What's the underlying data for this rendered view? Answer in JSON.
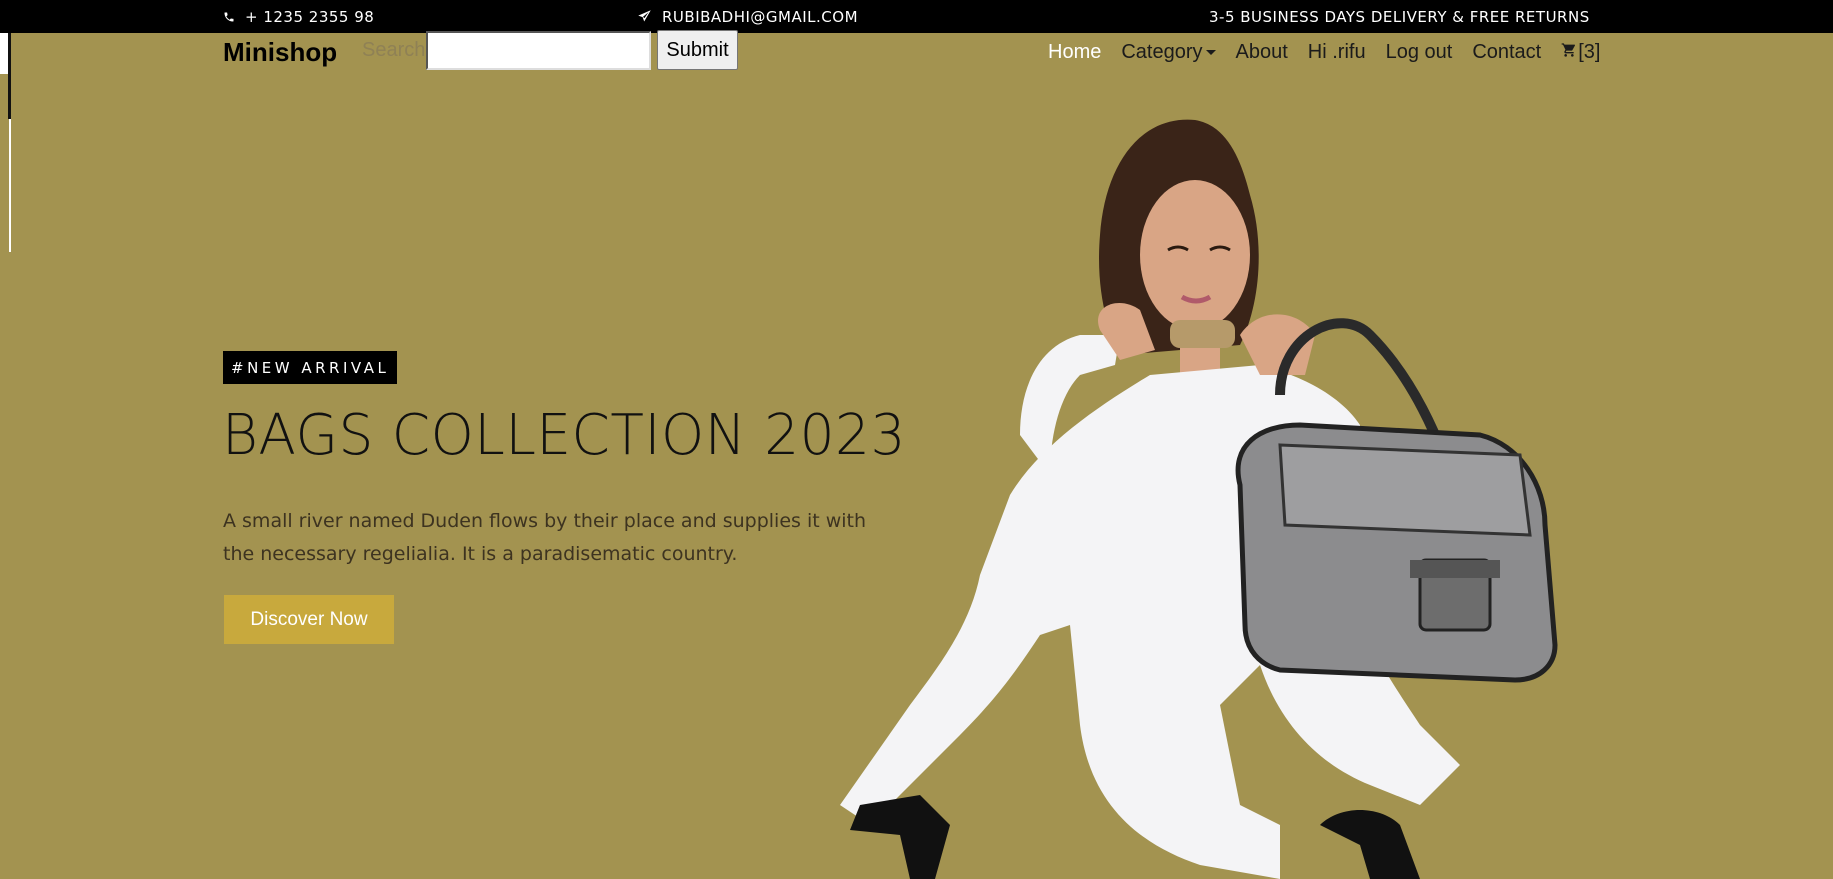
{
  "topbar": {
    "phone": "+ 1235 2355 98",
    "email": "RUBIBADHI@GMAIL.COM",
    "shipping": "3-5 BUSINESS DAYS DELIVERY & FREE RETURNS",
    "phone_icon": "phone-icon",
    "email_icon": "paper-plane-icon"
  },
  "navbar": {
    "brand": "Minishop",
    "search_label": "Search",
    "search_value": "",
    "submit_label": "Submit",
    "items": [
      {
        "label": "Home"
      },
      {
        "label": "Category"
      },
      {
        "label": "About"
      },
      {
        "label": "Hi .rifu"
      },
      {
        "label": "Log out"
      },
      {
        "label": "Contact"
      }
    ],
    "cart_count": "[3]",
    "cart_icon": "cart-icon"
  },
  "hero": {
    "badge": "#NEW ARRIVAL",
    "title": "BAGS COLLECTION 2023",
    "text": "A small river named Duden flows by their place and supplies it with the necessary regelialia. It is a paradisematic country.",
    "cta_label": "Discover Now",
    "background_color": "#a39350",
    "cta_color": "#c8a93d"
  }
}
